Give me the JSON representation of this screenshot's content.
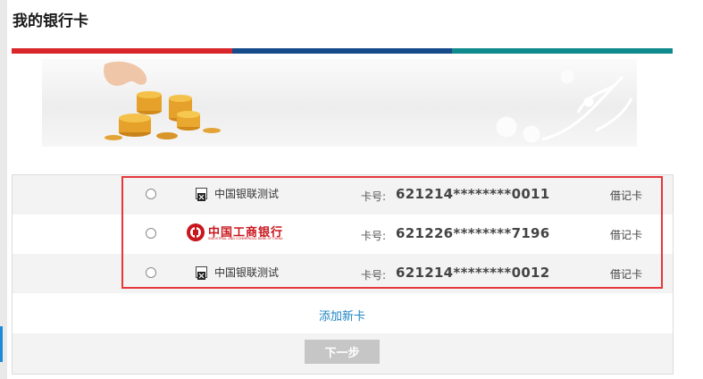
{
  "page": {
    "title": "我的银行卡"
  },
  "colors": {
    "stripe_red": "#d8262b",
    "stripe_blue": "#174b8b",
    "stripe_teal": "#0f8a8d",
    "highlight": "#e5383b",
    "link": "#1e84c5"
  },
  "card_label": "卡号:",
  "cards": [
    {
      "bank_name": "中国银联测试",
      "card_number": "621214********0011",
      "card_type": "借记卡",
      "logo": "broken-image-icon"
    },
    {
      "bank_name": "中国工商银行",
      "bank_name_en": "INDUSTRIAL AND COMMERCIAL BANK OF CHINA",
      "card_number": "621226********7196",
      "card_type": "借记卡",
      "logo": "icbc-logo"
    },
    {
      "bank_name": "中国银联测试",
      "card_number": "621214********0012",
      "card_type": "借记卡",
      "logo": "broken-image-icon"
    }
  ],
  "actions": {
    "add_card": "添加新卡",
    "next": "下一步"
  }
}
